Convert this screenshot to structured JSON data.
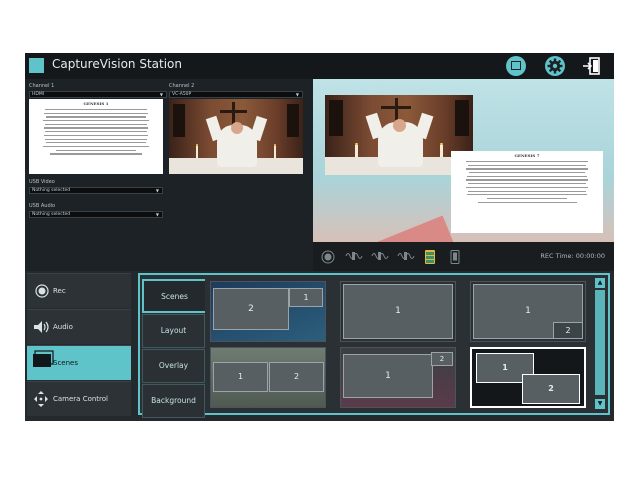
{
  "app": {
    "title": "CaptureVision Station"
  },
  "sources": {
    "channel1": {
      "label": "Channel 1",
      "value": "HDMI"
    },
    "channel2": {
      "label": "Channel 2",
      "value": "VC-A50P"
    },
    "usb_video": {
      "label": "USB Video",
      "value": "Nothing selected"
    },
    "usb_audio": {
      "label": "USB Audio",
      "value": "Nothing selected"
    }
  },
  "document": {
    "title": "GENESIS 1"
  },
  "preview_document": {
    "title": "GENESIS 7"
  },
  "controls": {
    "rec_time": "REC Time: 00:00:00"
  },
  "sidebar": {
    "items": [
      {
        "label": "Rec",
        "icon": "record-icon"
      },
      {
        "label": "Audio",
        "icon": "speaker-icon"
      },
      {
        "label": "Scenes",
        "icon": "scenes-icon",
        "active": true
      },
      {
        "label": "Camera Control",
        "icon": "camera-control-icon"
      }
    ]
  },
  "tabs": [
    "Scenes",
    "Layout",
    "Overlay",
    "Background"
  ],
  "layouts": {
    "n1": "1",
    "n2": "2"
  },
  "colors": {
    "accent": "#5ec4c9",
    "background": "#1d2226",
    "header": "#14181b"
  }
}
